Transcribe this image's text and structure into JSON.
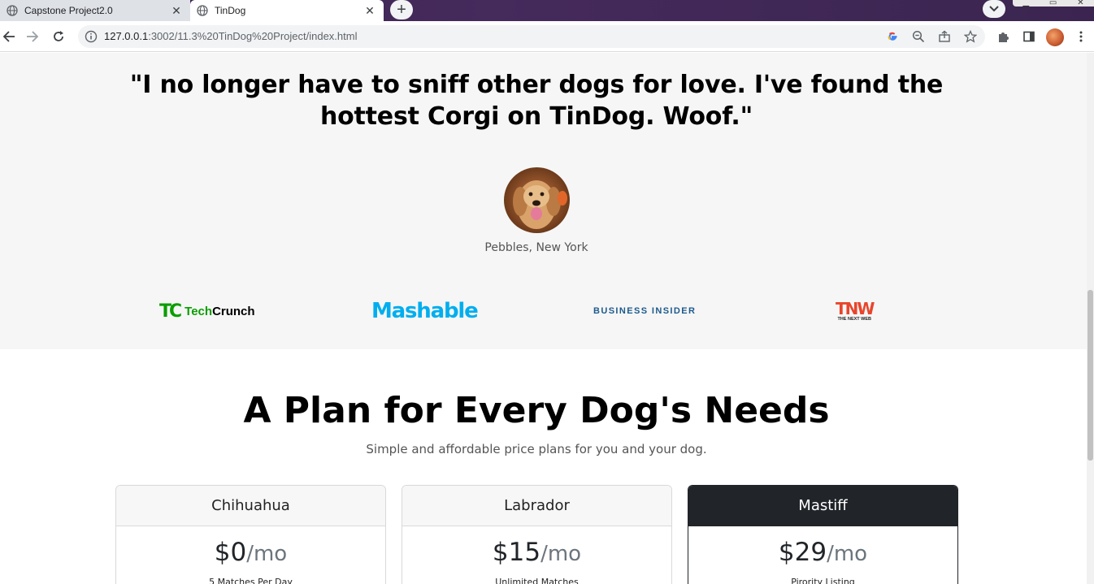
{
  "browser": {
    "tabs": [
      {
        "title": "Capstone Project2.0",
        "active": false
      },
      {
        "title": "TinDog",
        "active": true
      }
    ],
    "url_host": "127.0.0.1",
    "url_rest": ":3002/11.3%20TinDog%20Project/index.html",
    "new_tab_symbol": "+",
    "close_symbol": "✕"
  },
  "testimonial": {
    "quote": "\"I no longer have to sniff other dogs for love. I've found the hottest Corgi on TinDog. Woof.\"",
    "caption": "Pebbles, New York"
  },
  "press": {
    "techcrunch_mark": "TC",
    "techcrunch_word_1": "Tech",
    "techcrunch_word_2": "Crunch",
    "mashable": "Mashable",
    "business_insider": "BUSINESS INSIDER",
    "tnw_big": "TNW",
    "tnw_small": "THE NEXT WEB"
  },
  "pricing": {
    "title": "A Plan for Every Dog's Needs",
    "subtitle": "Simple and affordable price plans for you and your dog.",
    "plans": [
      {
        "name": "Chihuahua",
        "amount": "$0",
        "period": "/mo",
        "feature": "5 Matches Per Day"
      },
      {
        "name": "Labrador",
        "amount": "$15",
        "period": "/mo",
        "feature": "Unlimited Matches"
      },
      {
        "name": "Mastiff",
        "amount": "$29",
        "period": "/mo",
        "feature": "Pirority Listing"
      }
    ]
  },
  "colors": {
    "techcrunch": "#0a9e01",
    "mashable": "#00aeef",
    "business_insider": "#1c5a8c",
    "tnw": "#e8452c",
    "dark_card": "#212529"
  }
}
